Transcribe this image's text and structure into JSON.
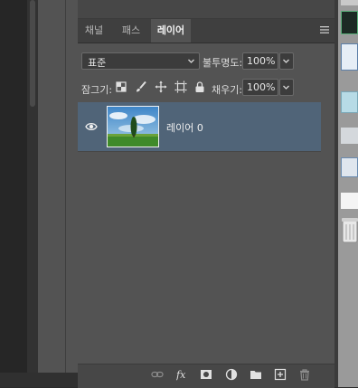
{
  "panel": {
    "tabs": [
      {
        "label": "채널",
        "active": false
      },
      {
        "label": "패스",
        "active": false
      },
      {
        "label": "레이어",
        "active": true
      }
    ],
    "menu_icon": "hamburger-menu-icon"
  },
  "blend": {
    "mode_value": "표준",
    "opacity_label": "불투명도:",
    "opacity_value": "100%"
  },
  "lock": {
    "label": "잠그기:",
    "icons": [
      "lock-transparent-pixels-icon",
      "lock-image-pixels-icon",
      "lock-position-icon",
      "lock-artboard-icon",
      "lock-all-icon"
    ],
    "fill_label": "채우기:",
    "fill_value": "100%"
  },
  "layers": [
    {
      "name": "레이어 0",
      "visible": true,
      "selected": true,
      "thumbnail": "tree-field-sky-thumbnail"
    }
  ],
  "toolbar": {
    "icons": [
      "link-layers-icon",
      "fx-icon",
      "layer-mask-icon",
      "adjustment-layer-icon",
      "group-folder-icon",
      "new-layer-icon",
      "trash-icon"
    ]
  },
  "colors": {
    "panel_bg": "#535353",
    "selected_row": "#506478",
    "tab_bar": "#3f3f3f"
  }
}
